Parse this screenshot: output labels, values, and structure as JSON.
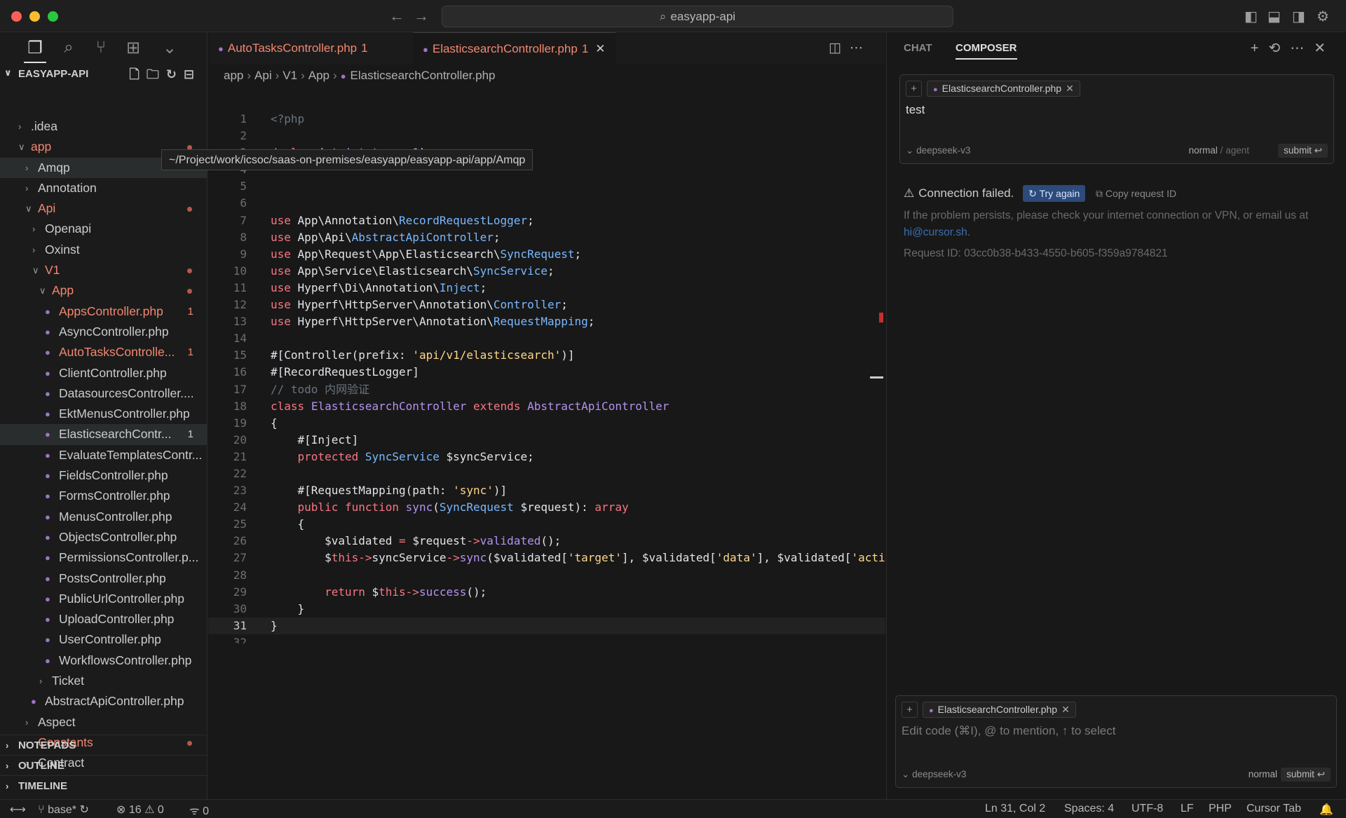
{
  "window": {
    "search_title": "easyapp-api"
  },
  "activity_icons": [
    "files-icon",
    "search-icon",
    "source-control-icon",
    "extensions-icon",
    "chevron-down-icon"
  ],
  "explorer": {
    "title": "EASYAPP-API",
    "tree": [
      {
        "label": ".idea",
        "depth": 1,
        "type": "folder",
        "open": false
      },
      {
        "label": "app",
        "depth": 1,
        "type": "folder",
        "open": true,
        "modified": true,
        "dot": true
      },
      {
        "label": "Amqp",
        "depth": 2,
        "type": "folder",
        "open": false,
        "selected": true
      },
      {
        "label": "Annotation",
        "depth": 2,
        "type": "folder",
        "open": false
      },
      {
        "label": "Api",
        "depth": 2,
        "type": "folder",
        "open": true,
        "modified": true,
        "dot": true
      },
      {
        "label": "Openapi",
        "depth": 3,
        "type": "folder",
        "open": false
      },
      {
        "label": "Oxinst",
        "depth": 3,
        "type": "folder",
        "open": false
      },
      {
        "label": "V1",
        "depth": 3,
        "type": "folder",
        "open": true,
        "modified": true,
        "dot": true
      },
      {
        "label": "App",
        "depth": 4,
        "type": "folder",
        "open": true,
        "modified": true,
        "dot": true
      },
      {
        "label": "AppsController.php",
        "depth": 5,
        "type": "file",
        "modified": true,
        "badge": "1"
      },
      {
        "label": "AsyncController.php",
        "depth": 5,
        "type": "file"
      },
      {
        "label": "AutoTasksControlle...",
        "depth": 5,
        "type": "file",
        "modified": true,
        "badge": "1"
      },
      {
        "label": "ClientController.php",
        "depth": 5,
        "type": "file"
      },
      {
        "label": "DatasourcesController....",
        "depth": 5,
        "type": "file"
      },
      {
        "label": "EktMenusController.php",
        "depth": 5,
        "type": "file"
      },
      {
        "label": "ElasticsearchContr...",
        "depth": 5,
        "type": "file",
        "selected": true,
        "badge": "1",
        "badge_plain": true
      },
      {
        "label": "EvaluateTemplatesContr...",
        "depth": 5,
        "type": "file"
      },
      {
        "label": "FieldsController.php",
        "depth": 5,
        "type": "file"
      },
      {
        "label": "FormsController.php",
        "depth": 5,
        "type": "file"
      },
      {
        "label": "MenusController.php",
        "depth": 5,
        "type": "file"
      },
      {
        "label": "ObjectsController.php",
        "depth": 5,
        "type": "file"
      },
      {
        "label": "PermissionsController.p...",
        "depth": 5,
        "type": "file"
      },
      {
        "label": "PostsController.php",
        "depth": 5,
        "type": "file"
      },
      {
        "label": "PublicUrlController.php",
        "depth": 5,
        "type": "file"
      },
      {
        "label": "UploadController.php",
        "depth": 5,
        "type": "file"
      },
      {
        "label": "UserController.php",
        "depth": 5,
        "type": "file"
      },
      {
        "label": "WorkflowsController.php",
        "depth": 5,
        "type": "file"
      },
      {
        "label": "Ticket",
        "depth": 4,
        "type": "folder",
        "open": false
      },
      {
        "label": "AbstractApiController.php",
        "depth": 3,
        "type": "file"
      },
      {
        "label": "Aspect",
        "depth": 2,
        "type": "folder",
        "open": false
      },
      {
        "label": "Constants",
        "depth": 2,
        "type": "folder",
        "open": false,
        "modified": true,
        "dot": true
      },
      {
        "label": "Contract",
        "depth": 2,
        "type": "folder",
        "open": false
      }
    ],
    "sections": [
      "NOTEPADS",
      "OUTLINE",
      "TIMELINE"
    ]
  },
  "tooltip": "~/Project/work/icsoc/saas-on-premises/easyapp/easyapp-api/app/Amqp",
  "editor": {
    "tabs": [
      {
        "label": "AutoTasksController.php",
        "count": "1",
        "active": false
      },
      {
        "label": "ElasticsearchController.php",
        "count": "1",
        "active": true
      }
    ],
    "breadcrumb": [
      "app",
      "Api",
      "V1",
      "App",
      "ElasticsearchController.php"
    ],
    "lines": [
      {
        "n": "1",
        "h": "<span class=\"c\">&lt;?php</span>"
      },
      {
        "n": "2",
        "h": ""
      },
      {
        "n": "3",
        "h": "<span class=\"k\">declare</span><span class=\"p\">(</span><span class=\"n\">strict_types</span><span class=\"k\">=</span><span class=\"n\">1</span><span class=\"p\">);</span>"
      },
      {
        "n": "4",
        "h": ""
      },
      {
        "n": "5",
        "h": ""
      },
      {
        "n": "6",
        "h": ""
      },
      {
        "n": "7",
        "h": "<span class=\"k\">use</span> <span class=\"p\">App\\Annotation\\</span><span class=\"n\">RecordRequestLogger</span><span class=\"p\">;</span>"
      },
      {
        "n": "8",
        "h": "<span class=\"k\">use</span> <span class=\"p\">App\\Api\\</span><span class=\"n\">AbstractApiController</span><span class=\"p\">;</span>"
      },
      {
        "n": "9",
        "h": "<span class=\"k\">use</span> <span class=\"p\">App\\Request\\App\\Elasticsearch\\</span><span class=\"n\">SyncRequest</span><span class=\"p\">;</span>"
      },
      {
        "n": "10",
        "h": "<span class=\"k\">use</span> <span class=\"p\">App\\Service\\Elasticsearch\\</span><span class=\"n\">SyncService</span><span class=\"p\">;</span>"
      },
      {
        "n": "11",
        "h": "<span class=\"k\">use</span> <span class=\"p\">Hyperf\\Di\\Annotation\\</span><span class=\"n\">Inject</span><span class=\"p\">;</span>"
      },
      {
        "n": "12",
        "h": "<span class=\"k\">use</span> <span class=\"p\">Hyperf\\HttpServer\\Annotation\\</span><span class=\"n\">Controller</span><span class=\"p\">;</span>"
      },
      {
        "n": "13",
        "h": "<span class=\"k\">use</span> <span class=\"p\">Hyperf\\HttpServer\\Annotation\\</span><span class=\"n\">RequestMapping</span><span class=\"p\">;</span>"
      },
      {
        "n": "14",
        "h": ""
      },
      {
        "n": "15",
        "h": "<span class=\"p\">#[Controller(</span><span class=\"p\">prefix:</span> <span class=\"s\">'api/v1/elasticsearch'</span><span class=\"p\">)]</span>"
      },
      {
        "n": "16",
        "h": "<span class=\"p\">#[RecordRequestLogger]</span>"
      },
      {
        "n": "17",
        "h": "<span class=\"c\">// todo 内网验证</span>"
      },
      {
        "n": "18",
        "h": "<span class=\"k\">class</span> <span class=\"a\">ElasticsearchController</span> <span class=\"k\">extends</span> <span class=\"a\">AbstractApiController</span>"
      },
      {
        "n": "19",
        "h": "<span class=\"p\">{</span>"
      },
      {
        "n": "20",
        "h": "    <span class=\"p\">#[Inject]</span>"
      },
      {
        "n": "21",
        "h": "    <span class=\"k\">protected</span> <span class=\"n\">SyncService</span> <span class=\"p\">$syncService;</span>"
      },
      {
        "n": "22",
        "h": ""
      },
      {
        "n": "23",
        "h": "    <span class=\"p\">#[RequestMapping(</span><span class=\"p\">path:</span> <span class=\"s\">'sync'</span><span class=\"p\">)]</span>"
      },
      {
        "n": "24",
        "h": "    <span class=\"k\">public</span> <span class=\"k\">function</span> <span class=\"a\">sync</span><span class=\"p\">(</span><span class=\"n\">SyncRequest</span> <span class=\"p\">$request):</span> <span class=\"k\">array</span>"
      },
      {
        "n": "25",
        "h": "    <span class=\"p\">{</span>"
      },
      {
        "n": "26",
        "h": "        <span class=\"p\">$validated</span> <span class=\"k\">=</span> <span class=\"p\">$request</span><span class=\"k\">-&gt;</span><span class=\"a\">validated</span><span class=\"p\">();</span>"
      },
      {
        "n": "27",
        "h": "        <span class=\"p\">$</span><span class=\"k\">this</span><span class=\"k\">-&gt;</span><span class=\"p\">syncService</span><span class=\"k\">-&gt;</span><span class=\"a\">sync</span><span class=\"p\">($validated[</span><span class=\"s\">'target'</span><span class=\"p\">], $validated[</span><span class=\"s\">'data'</span><span class=\"p\">], $validated[</span><span class=\"s\">'acti</span>"
      },
      {
        "n": "28",
        "h": ""
      },
      {
        "n": "29",
        "h": "        <span class=\"k\">return</span> <span class=\"p\">$</span><span class=\"k\">this</span><span class=\"k\">-&gt;</span><span class=\"a\">success</span><span class=\"p\">();</span>"
      },
      {
        "n": "30",
        "h": "    <span class=\"p\">}</span>"
      },
      {
        "n": "31",
        "h": "<span class=\"p\">}</span>",
        "current": true
      },
      {
        "n": "32",
        "h": ""
      }
    ]
  },
  "right_panel": {
    "tabs": [
      "CHAT",
      "COMPOSER"
    ],
    "context_file": "ElasticsearchController.php",
    "composer_text": "test",
    "model": "deepseek-v3",
    "mode_normal": "normal",
    "mode_sep": "/",
    "mode_agent": "agent",
    "submit": "submit",
    "error_title": "Connection failed.",
    "try_again": "Try again",
    "copy_request": "Copy request ID",
    "error_desc": "If the problem persists, please check your internet connection or VPN, or email us at",
    "error_email": "hi@cursor.sh",
    "error_end": ".",
    "request_id": "Request ID: 03cc0b38-b433-4550-b605-f359a9784821",
    "bottom_context_file": "ElasticsearchController.php",
    "bottom_placeholder": "Edit code (⌘I), @ to mention, ↑ to select",
    "bottom_model": "deepseek-v3",
    "bottom_mode": "normal",
    "bottom_submit": "submit"
  },
  "status": {
    "branch": "base*",
    "errors": "16",
    "warnings": "0",
    "ports": "0",
    "position": "Ln 31, Col 2",
    "spaces": "Spaces: 4",
    "encoding": "UTF-8",
    "eol": "LF",
    "language": "PHP",
    "cursor_tab": "Cursor Tab"
  }
}
